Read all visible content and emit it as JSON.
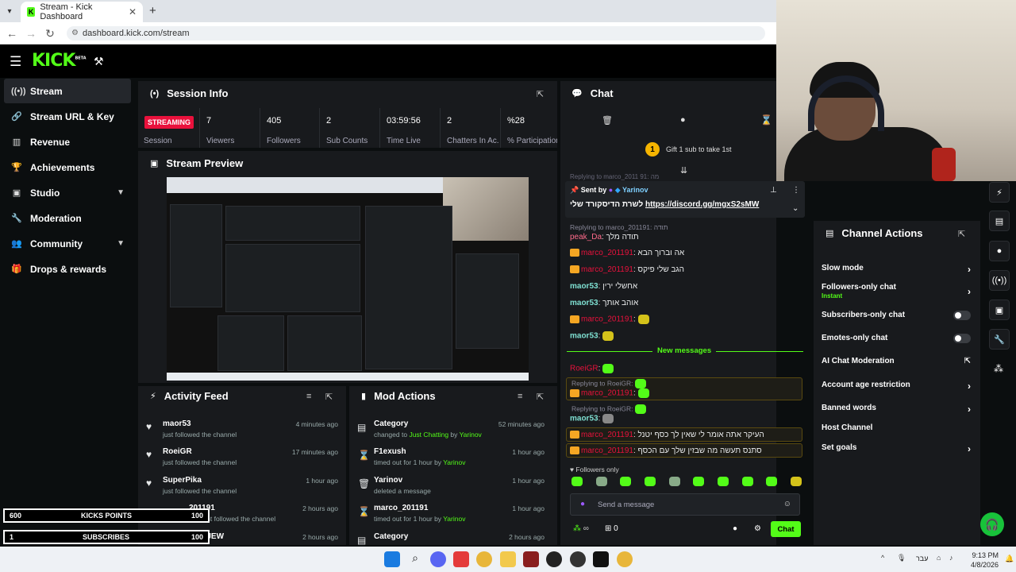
{
  "browser": {
    "tab_title": "Stream - Kick Dashboard",
    "url": "dashboard.kick.com/stream",
    "tab_close": "✕",
    "new_tab": "+"
  },
  "app": {
    "logo": "KICK",
    "logo_badge": "BETA"
  },
  "sidebar": {
    "items": [
      {
        "label": "Stream",
        "icon": "signal-icon"
      },
      {
        "label": "Stream URL & Key",
        "icon": "link-icon"
      },
      {
        "label": "Revenue",
        "icon": "chart-icon"
      },
      {
        "label": "Achievements",
        "icon": "trophy-icon"
      },
      {
        "label": "Studio",
        "icon": "studio-icon"
      },
      {
        "label": "Moderation",
        "icon": "wrench-icon"
      },
      {
        "label": "Community",
        "icon": "people-icon"
      },
      {
        "label": "Drops & rewards",
        "icon": "gift-icon"
      }
    ]
  },
  "session": {
    "title": "Session Info",
    "status": "STREAMING",
    "label": "Session",
    "stats": [
      {
        "value": "7",
        "label": "Viewers"
      },
      {
        "value": "405",
        "label": "Followers"
      },
      {
        "value": "2",
        "label": "Sub Counts"
      },
      {
        "value": "03:59:56",
        "label": "Time Live"
      },
      {
        "value": "2",
        "label": "Chatters In Ac..."
      },
      {
        "value": "%28",
        "label": "% Participation"
      }
    ]
  },
  "preview": {
    "title": "Stream Preview"
  },
  "activity": {
    "title": "Activity Feed",
    "items": [
      {
        "name": "maor53",
        "action": "just followed the channel",
        "ago": "4 minutes ago"
      },
      {
        "name": "RoeiGR",
        "action": "just followed the channel",
        "ago": "17 minutes ago"
      },
      {
        "name": "SuperPika",
        "action": "just followed the channel",
        "ago": "1 hour ago"
      },
      {
        "name": "201191",
        "action": "just followed the channel",
        "ago": "2 hours ago"
      },
      {
        "name": "WALTERSAJEW",
        "action": "",
        "ago": "2 hours ago"
      }
    ]
  },
  "mod": {
    "title": "Mod Actions",
    "items": [
      {
        "name": "Category",
        "pre": "changed to ",
        "hl": "Just Chatting",
        "mid": " by ",
        "by": "Yarinov",
        "ago": "52 minutes ago"
      },
      {
        "name": "F1exush",
        "pre": "timed out for 1 hour by ",
        "hl": "",
        "mid": "",
        "by": "Yarinov",
        "ago": "1 hour ago"
      },
      {
        "name": "Yarinov",
        "pre": "deleted a message",
        "hl": "",
        "mid": "",
        "by": "",
        "ago": "1 hour ago"
      },
      {
        "name": "marco_201191",
        "pre": "timed out for 1 hour by ",
        "hl": "",
        "mid": "",
        "by": "Yarinov",
        "ago": "1 hour ago"
      },
      {
        "name": "Category",
        "pre": "",
        "hl": "",
        "mid": "",
        "by": "",
        "ago": "2 hours ago"
      }
    ]
  },
  "chat": {
    "title": "Chat",
    "gift_count": "1",
    "gift_text": "Gift 1 sub to take 1st",
    "replying_top": "Replying to marco_2011 91: מה",
    "pinned": {
      "sent_by": "Sent by",
      "user": "Yarinov",
      "text": "לשרת הדיסקורד שלי",
      "link": "https://discord.gg/mgxS2sMW"
    },
    "replying1": "Replying to marco_201191: תודה",
    "messages": [
      {
        "user": "peak_Da",
        "text": "תודה מלך"
      },
      {
        "user": "marco_201191",
        "text": "אה וברוך הבא"
      },
      {
        "user": "marco_201191",
        "text": "הגב שלי פיקס"
      },
      {
        "user": "maor53",
        "text": "אחשלי ירין"
      },
      {
        "user": "maor53",
        "text": "אוהב אותך"
      },
      {
        "user": "marco_201191",
        "text": ""
      },
      {
        "user": "maor53",
        "text": ""
      }
    ],
    "new_messages": "New messages",
    "roei": {
      "user": "RoeiGR"
    },
    "reply_roei": "Replying to RoeiGR:",
    "marco_reply_user": "marco_201191",
    "reply_roei2": "Replying to RoeiGR:",
    "maor_reply_user": "maor53",
    "hl1": {
      "user": "marco_201191",
      "text": "העיקר אתה אומר לי שאין לך כסף יטנל"
    },
    "hl2": {
      "user": "marco_201191",
      "text": "סתנס תעשה מה שבזין שלך עם הכסף"
    },
    "followers_only": "Followers only",
    "input_placeholder": "Send a message",
    "points": "∞",
    "count": "0",
    "send": "Chat"
  },
  "channel_actions": {
    "title": "Channel Actions",
    "rows": [
      {
        "label": "Slow mode",
        "kind": "arrow"
      },
      {
        "label": "Followers-only chat",
        "sub": "Instant",
        "kind": "arrow"
      },
      {
        "label": "Subscribers-only chat",
        "kind": "toggle"
      },
      {
        "label": "Emotes-only chat",
        "kind": "toggle"
      },
      {
        "label": "AI Chat Moderation",
        "kind": "link"
      },
      {
        "label": "Account age restriction",
        "kind": "arrow"
      },
      {
        "label": "Banned words",
        "kind": "arrow"
      },
      {
        "label": "Host Channel",
        "kind": "none"
      },
      {
        "label": "Set goals",
        "kind": "arrow"
      }
    ]
  },
  "overlay": {
    "kicks": {
      "left": "600",
      "mid": "KICKS POINTS",
      "right": "100"
    },
    "subs": {
      "left": "1",
      "mid": "SUBSCRIBES",
      "right": "100"
    }
  },
  "taskbar": {
    "lang": "עבר",
    "time": "9:13 PM",
    "date": "4/8/2026"
  },
  "colors": {
    "accent": "#53fc18",
    "live": "#e9113c",
    "panel": "#181a1d"
  }
}
